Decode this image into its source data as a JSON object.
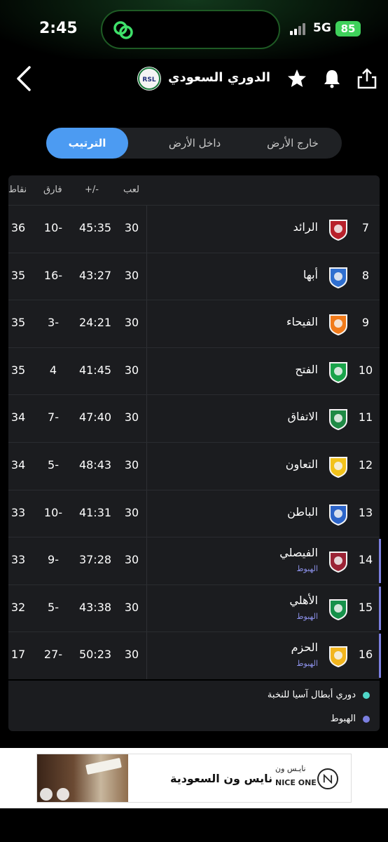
{
  "status_bar": {
    "time": "2:45",
    "network": "5G",
    "battery": "85"
  },
  "header": {
    "title": "الدوري السعودي",
    "logo_text": "RSL"
  },
  "tabs": [
    {
      "label": "الترتيب",
      "active": true
    },
    {
      "label": "داخل الأرض",
      "active": false
    },
    {
      "label": "خارج الأرض",
      "active": false
    }
  ],
  "table": {
    "columns": {
      "played": "لعب",
      "score": "+/-",
      "diff": "فارق",
      "points": "نقاط"
    },
    "rows": [
      {
        "pos": "7",
        "team": "الرائد",
        "played": "30",
        "score": "45:35",
        "diff": "10-",
        "points": "36",
        "note": "",
        "crest_color": "#b8212b"
      },
      {
        "pos": "8",
        "team": "أبها",
        "played": "30",
        "score": "43:27",
        "diff": "16-",
        "points": "35",
        "note": "",
        "crest_color": "#2f6fd0"
      },
      {
        "pos": "9",
        "team": "الفيحاء",
        "played": "30",
        "score": "24:21",
        "diff": "3-",
        "points": "35",
        "note": "",
        "crest_color": "#f07a1a"
      },
      {
        "pos": "10",
        "team": "الفتح",
        "played": "30",
        "score": "41:45",
        "diff": "4",
        "points": "35",
        "note": "",
        "crest_color": "#1aa34a"
      },
      {
        "pos": "11",
        "team": "الاتفاق",
        "played": "30",
        "score": "47:40",
        "diff": "7-",
        "points": "34",
        "note": "",
        "crest_color": "#1f8a45"
      },
      {
        "pos": "12",
        "team": "التعاون",
        "played": "30",
        "score": "48:43",
        "diff": "5-",
        "points": "34",
        "note": "",
        "crest_color": "#f2c21b"
      },
      {
        "pos": "13",
        "team": "الباطن",
        "played": "30",
        "score": "41:31",
        "diff": "10-",
        "points": "33",
        "note": "",
        "crest_color": "#2c64c8"
      },
      {
        "pos": "14",
        "team": "الفيصلي",
        "played": "30",
        "score": "37:28",
        "diff": "9-",
        "points": "33",
        "note": "الهبوط",
        "crest_color": "#9b2335"
      },
      {
        "pos": "15",
        "team": "الأهلي",
        "played": "30",
        "score": "43:38",
        "diff": "5-",
        "points": "32",
        "note": "الهبوط",
        "crest_color": "#16914a"
      },
      {
        "pos": "16",
        "team": "الحزم",
        "played": "30",
        "score": "50:23",
        "diff": "27-",
        "points": "17",
        "note": "الهبوط",
        "crest_color": "#f2b51e"
      }
    ]
  },
  "legend": [
    {
      "label": "دوري أبطال آسيا للنخبة",
      "color": "#4fd6c8"
    },
    {
      "label": "الهبوط",
      "color": "#7b7fe0"
    }
  ],
  "ad": {
    "headline": "نايس ون السعودية",
    "brand_ar": "نايـس ون",
    "brand_en": "NICE ONE"
  }
}
